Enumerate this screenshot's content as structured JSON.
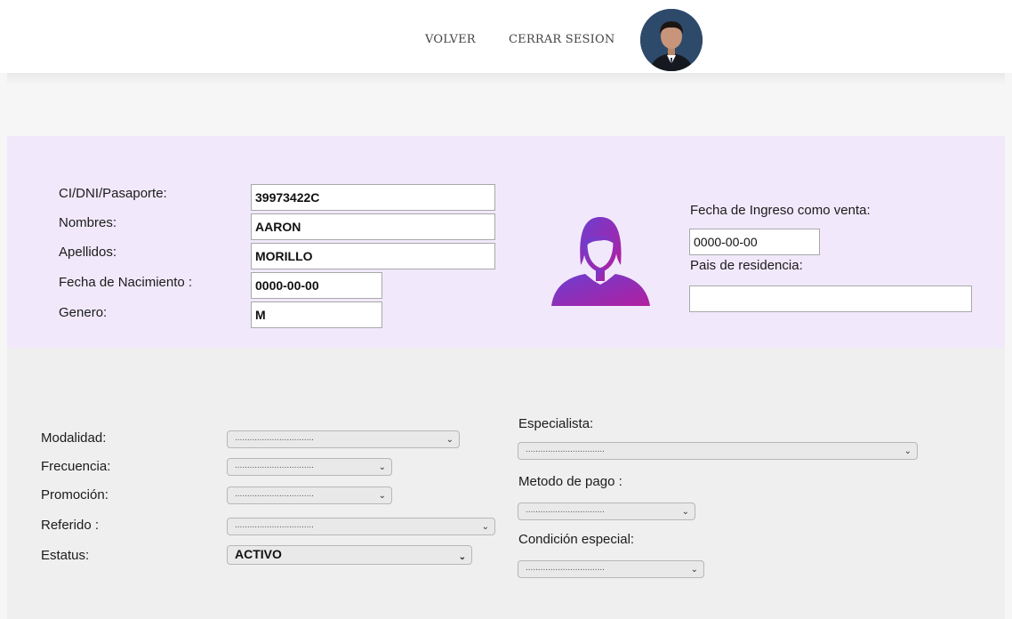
{
  "nav": {
    "back_label": "VOLVER",
    "logout_label": "CERRAR SESION"
  },
  "profile": {
    "id_label": "CI/DNI/Pasaporte:",
    "id_value": "39973422C",
    "names_label": "Nombres:",
    "names_value": "AARON",
    "surnames_label": "Apellidos:",
    "surnames_value": "MORILLO",
    "birth_label": "Fecha de Nacimiento :",
    "birth_value": "0000-00-00",
    "gender_label": "Genero:",
    "gender_value": "M",
    "entry_date_label": "Fecha de Ingreso como venta:",
    "entry_date_value": "0000-00-00",
    "country_label": "Pais de residencia:",
    "country_value": ""
  },
  "form": {
    "modalidad_label": "Modalidad:",
    "modalidad_value": "................................",
    "frecuencia_label": "Frecuencia:",
    "frecuencia_value": "................................",
    "promocion_label": "Promoción:",
    "promocion_value": "................................",
    "referido_label": "Referido :",
    "referido_value": "................................",
    "estatus_label": "Estatus:",
    "estatus_value": "ACTIVO",
    "especialista_label": "Especialista:",
    "especialista_value": "................................",
    "pago_label": "Metodo de pago :",
    "pago_value": "................................",
    "condicion_label": "Condición especial:",
    "condicion_value": "................................"
  },
  "colors": {
    "panel_top": "#f1e9fb",
    "panel_bottom": "#efefef",
    "icon_gradient_start": "#6b3fd0",
    "icon_gradient_end": "#b21fa0"
  },
  "icons": {
    "user_avatar": "avatar-photo",
    "person": "person-silhouette-icon",
    "caret": "chevron-down-icon"
  }
}
